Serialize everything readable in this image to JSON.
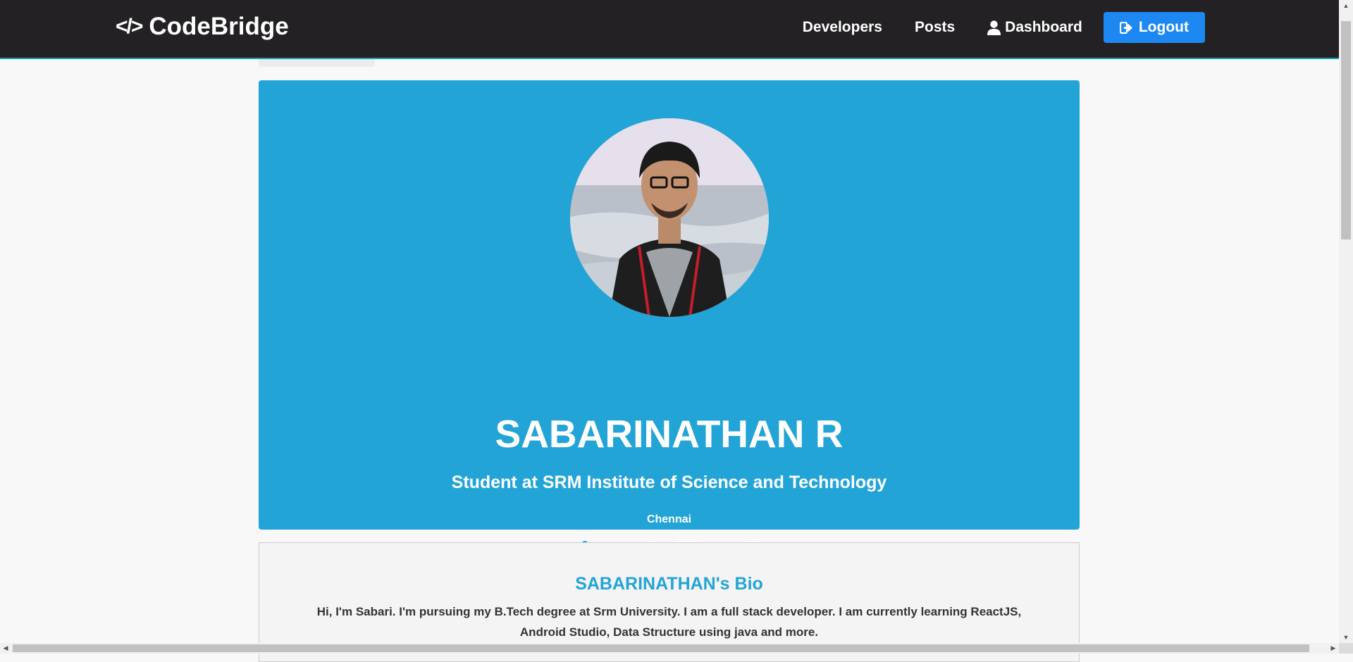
{
  "navbar": {
    "brand_icon": "</>",
    "brand": "CodeBridge",
    "links": [
      {
        "label": "Developers",
        "icon": "none"
      },
      {
        "label": "Posts",
        "icon": "none"
      },
      {
        "label": "Dashboard",
        "icon": "user-icon"
      }
    ],
    "logout": {
      "label": "Logout",
      "icon": "sign-out-icon"
    }
  },
  "profile": {
    "name": "SABARINATHAN R",
    "status": "Student at SRM Institute of Science and Technology",
    "location": "Chennai",
    "social": [
      "globe-icon",
      "twitter-icon",
      "facebook-icon",
      "linkedin-icon",
      "youtube-icon",
      "instagram-icon"
    ]
  },
  "bio": {
    "title": "SABARINATHAN's Bio",
    "text": "Hi, I'm Sabari. I'm pursuing my B.Tech degree at Srm University. I am a full stack developer. I am currently learning ReactJS, Android Studio, Data Structure using java and more."
  },
  "colors": {
    "navbar": "#232123",
    "primary": "#23a4d7",
    "logout_button": "#1e88f2",
    "page_bg": "#f8f8f8"
  }
}
